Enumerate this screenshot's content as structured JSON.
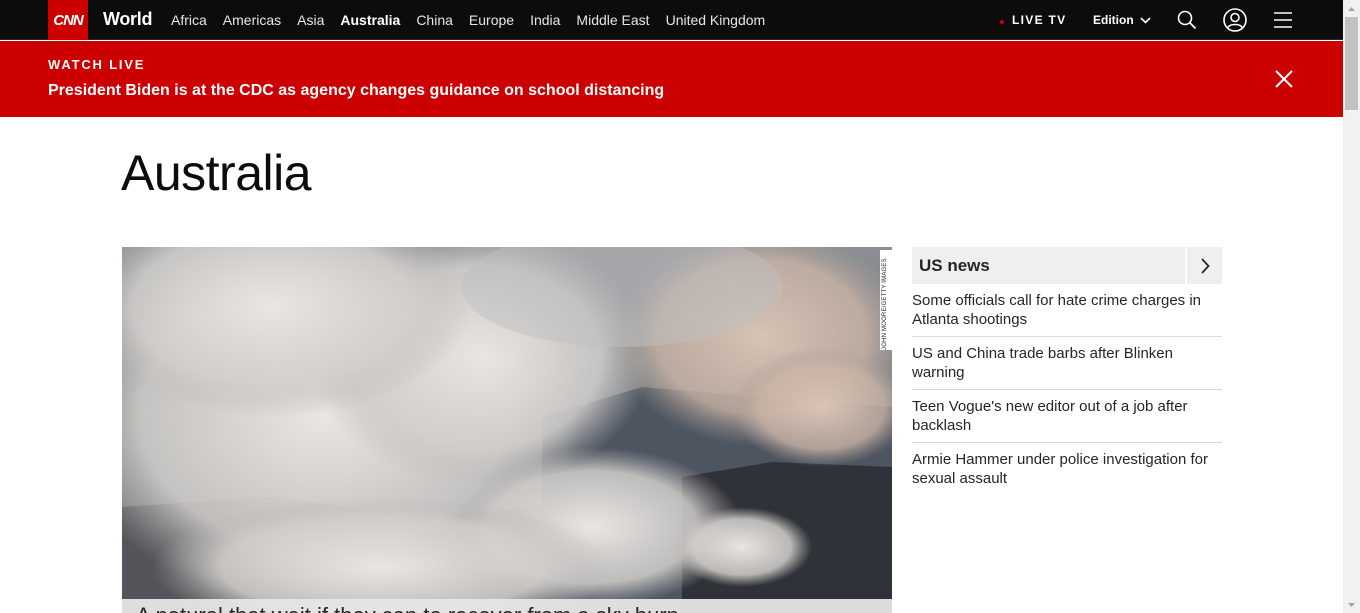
{
  "nav": {
    "logo": "CNN",
    "section": "World",
    "links": [
      {
        "label": "Africa",
        "active": false
      },
      {
        "label": "Americas",
        "active": false
      },
      {
        "label": "Asia",
        "active": false
      },
      {
        "label": "Australia",
        "active": true
      },
      {
        "label": "China",
        "active": false
      },
      {
        "label": "Europe",
        "active": false
      },
      {
        "label": "India",
        "active": false
      },
      {
        "label": "Middle East",
        "active": false
      },
      {
        "label": "United Kingdom",
        "active": false
      }
    ],
    "live_tv": "LIVE TV",
    "edition": "Edition",
    "icons": {
      "search": "search-icon",
      "account": "account-icon",
      "menu": "hamburger-menu-icon"
    }
  },
  "banner": {
    "kicker": "WATCH LIVE",
    "headline": "President Biden is at the CDC as agency changes guidance on school distancing",
    "close_icon": "close-icon"
  },
  "page": {
    "heading": "Australia"
  },
  "hero": {
    "credit": "JOHN MOORE/GETTY IMAGES",
    "caption": "A natural that wait if they can to recover from a sky burn"
  },
  "sidebar": {
    "title": "US news",
    "arrow_icon": "chevron-right-icon",
    "items": [
      "Some officials call for hate crime charges in Atlanta shootings",
      "US and China trade barbs after Blinken warning",
      "Teen Vogue's new editor out of a job after backlash",
      "Armie Hammer under police investigation for sexual assault"
    ]
  },
  "colors": {
    "brand_red": "#cc0000",
    "nav_bg": "#0c0c0c",
    "text": "#262626"
  }
}
